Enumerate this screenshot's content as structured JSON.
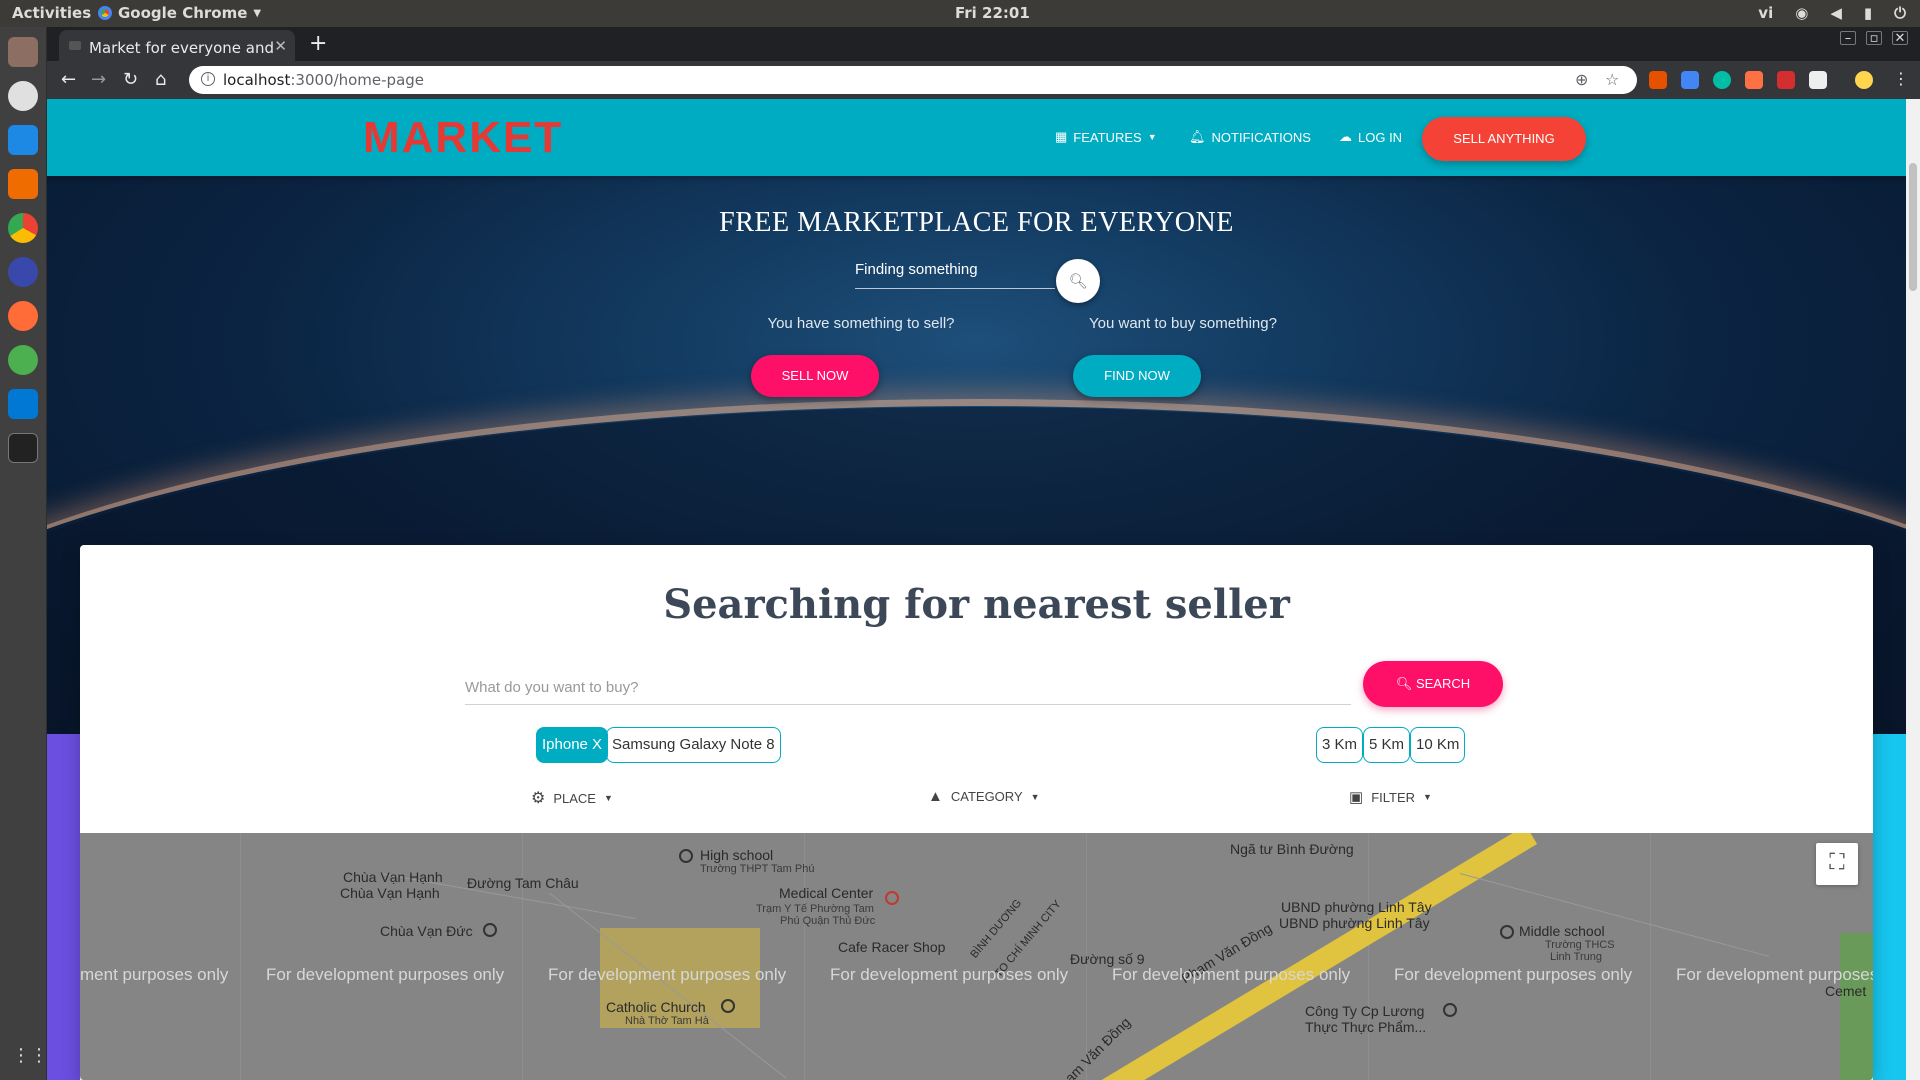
{
  "os": {
    "activities": "Activities",
    "app_name": "Google Chrome",
    "clock": "Fri 22:01",
    "lang": "vi"
  },
  "browser": {
    "tab_title": "Market for everyone and",
    "url_host": "localhost",
    "url_path": ":3000/home-page"
  },
  "navbar": {
    "logo": "MARKET",
    "features": "FEATURES",
    "notifications": "NOTIFICATIONS",
    "login": "LOG IN",
    "sell_anything": "SELL ANYTHING"
  },
  "hero": {
    "title": "FREE MARKETPLACE FOR EVERYONE",
    "search_placeholder": "Finding something",
    "sell_question": "You have something to sell?",
    "buy_question": "You want to buy something?",
    "sell_now": "SELL NOW",
    "find_now": "FIND NOW"
  },
  "search_card": {
    "title": "Searching for nearest seller",
    "placeholder": "What do you want to buy?",
    "search_button": "SEARCH",
    "products": [
      "Iphone X",
      "Samsung Galaxy Note 8"
    ],
    "distances": [
      "3 Km",
      "5 Km",
      "10 Km"
    ],
    "place": "PLACE",
    "category": "CATEGORY",
    "filter": "FILTER"
  },
  "map": {
    "watermark": "For development purposes only",
    "watermark_partial": "ment purposes only",
    "watermark_end": "For development purposes",
    "labels": {
      "nga_tu": "Ngã tư Bình Đường",
      "high_school": "High school",
      "high_school_sub": "Trường THPT Tam Phú",
      "chua_van_hanh_1": "Chùa Vạn Hạnh",
      "chua_van_hanh_2": "Chùa Vạn Hạnh",
      "duong_tam_chau": "Đường Tam Châu",
      "medical_center": "Medical Center",
      "medical_sub1": "Trạm Y Tế Phường Tam",
      "medical_sub2": "Phú Quận Thủ Đức",
      "ubnd_1": "UBND phường Linh Tây",
      "ubnd_2": "UBND phường Linh Tây",
      "chua_van_duc": "Chùa Vạn Đức",
      "cafe_racer": "Cafe Racer Shop",
      "duong_so_9": "Đường số 9",
      "pham_van_dong": "Phạm Văn Đồng",
      "pham_van_dong_2": "Phạm Văn Đồng",
      "middle_school": "Middle school",
      "middle_sub1": "Trường THCS",
      "middle_sub2": "Linh Trung",
      "catholic": "Catholic Church",
      "catholic_sub": "Nhà Thờ Tam Hà",
      "cong_ty_1": "Công Ty Cp Lương",
      "cong_ty_2": "Thực Thực Phẩm...",
      "cemetery": "Cemet",
      "binh_duong": "BÌNH DƯƠNG",
      "to_chi_minh": "TO CHÍ MINH CITY"
    }
  }
}
